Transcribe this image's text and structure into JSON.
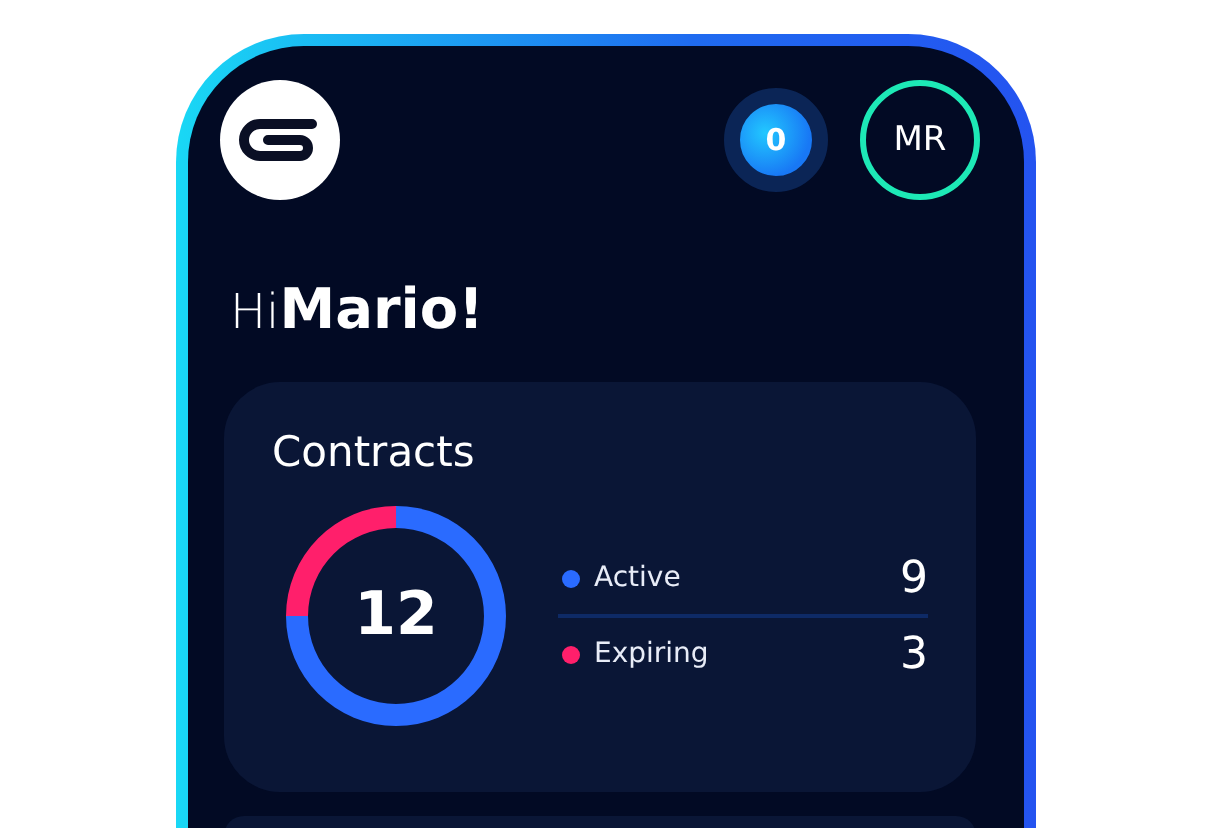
{
  "header": {
    "notifications": "0",
    "avatar": "MR"
  },
  "greeting": {
    "hi": "Hi",
    "name": "Mario!"
  },
  "contracts": {
    "total": "12",
    "legend": [
      {
        "value": "9",
        "color": "#2a6bff"
      },
      {
        "value": "3",
        "color": "#ff1f6b"
      }
    ],
    "chart_data": {
      "type": "donut",
      "title": "Contracts",
      "categories": [
        "Active",
        "Expiring"
      ],
      "values": [
        75,
        25
      ]
    }
  }
}
